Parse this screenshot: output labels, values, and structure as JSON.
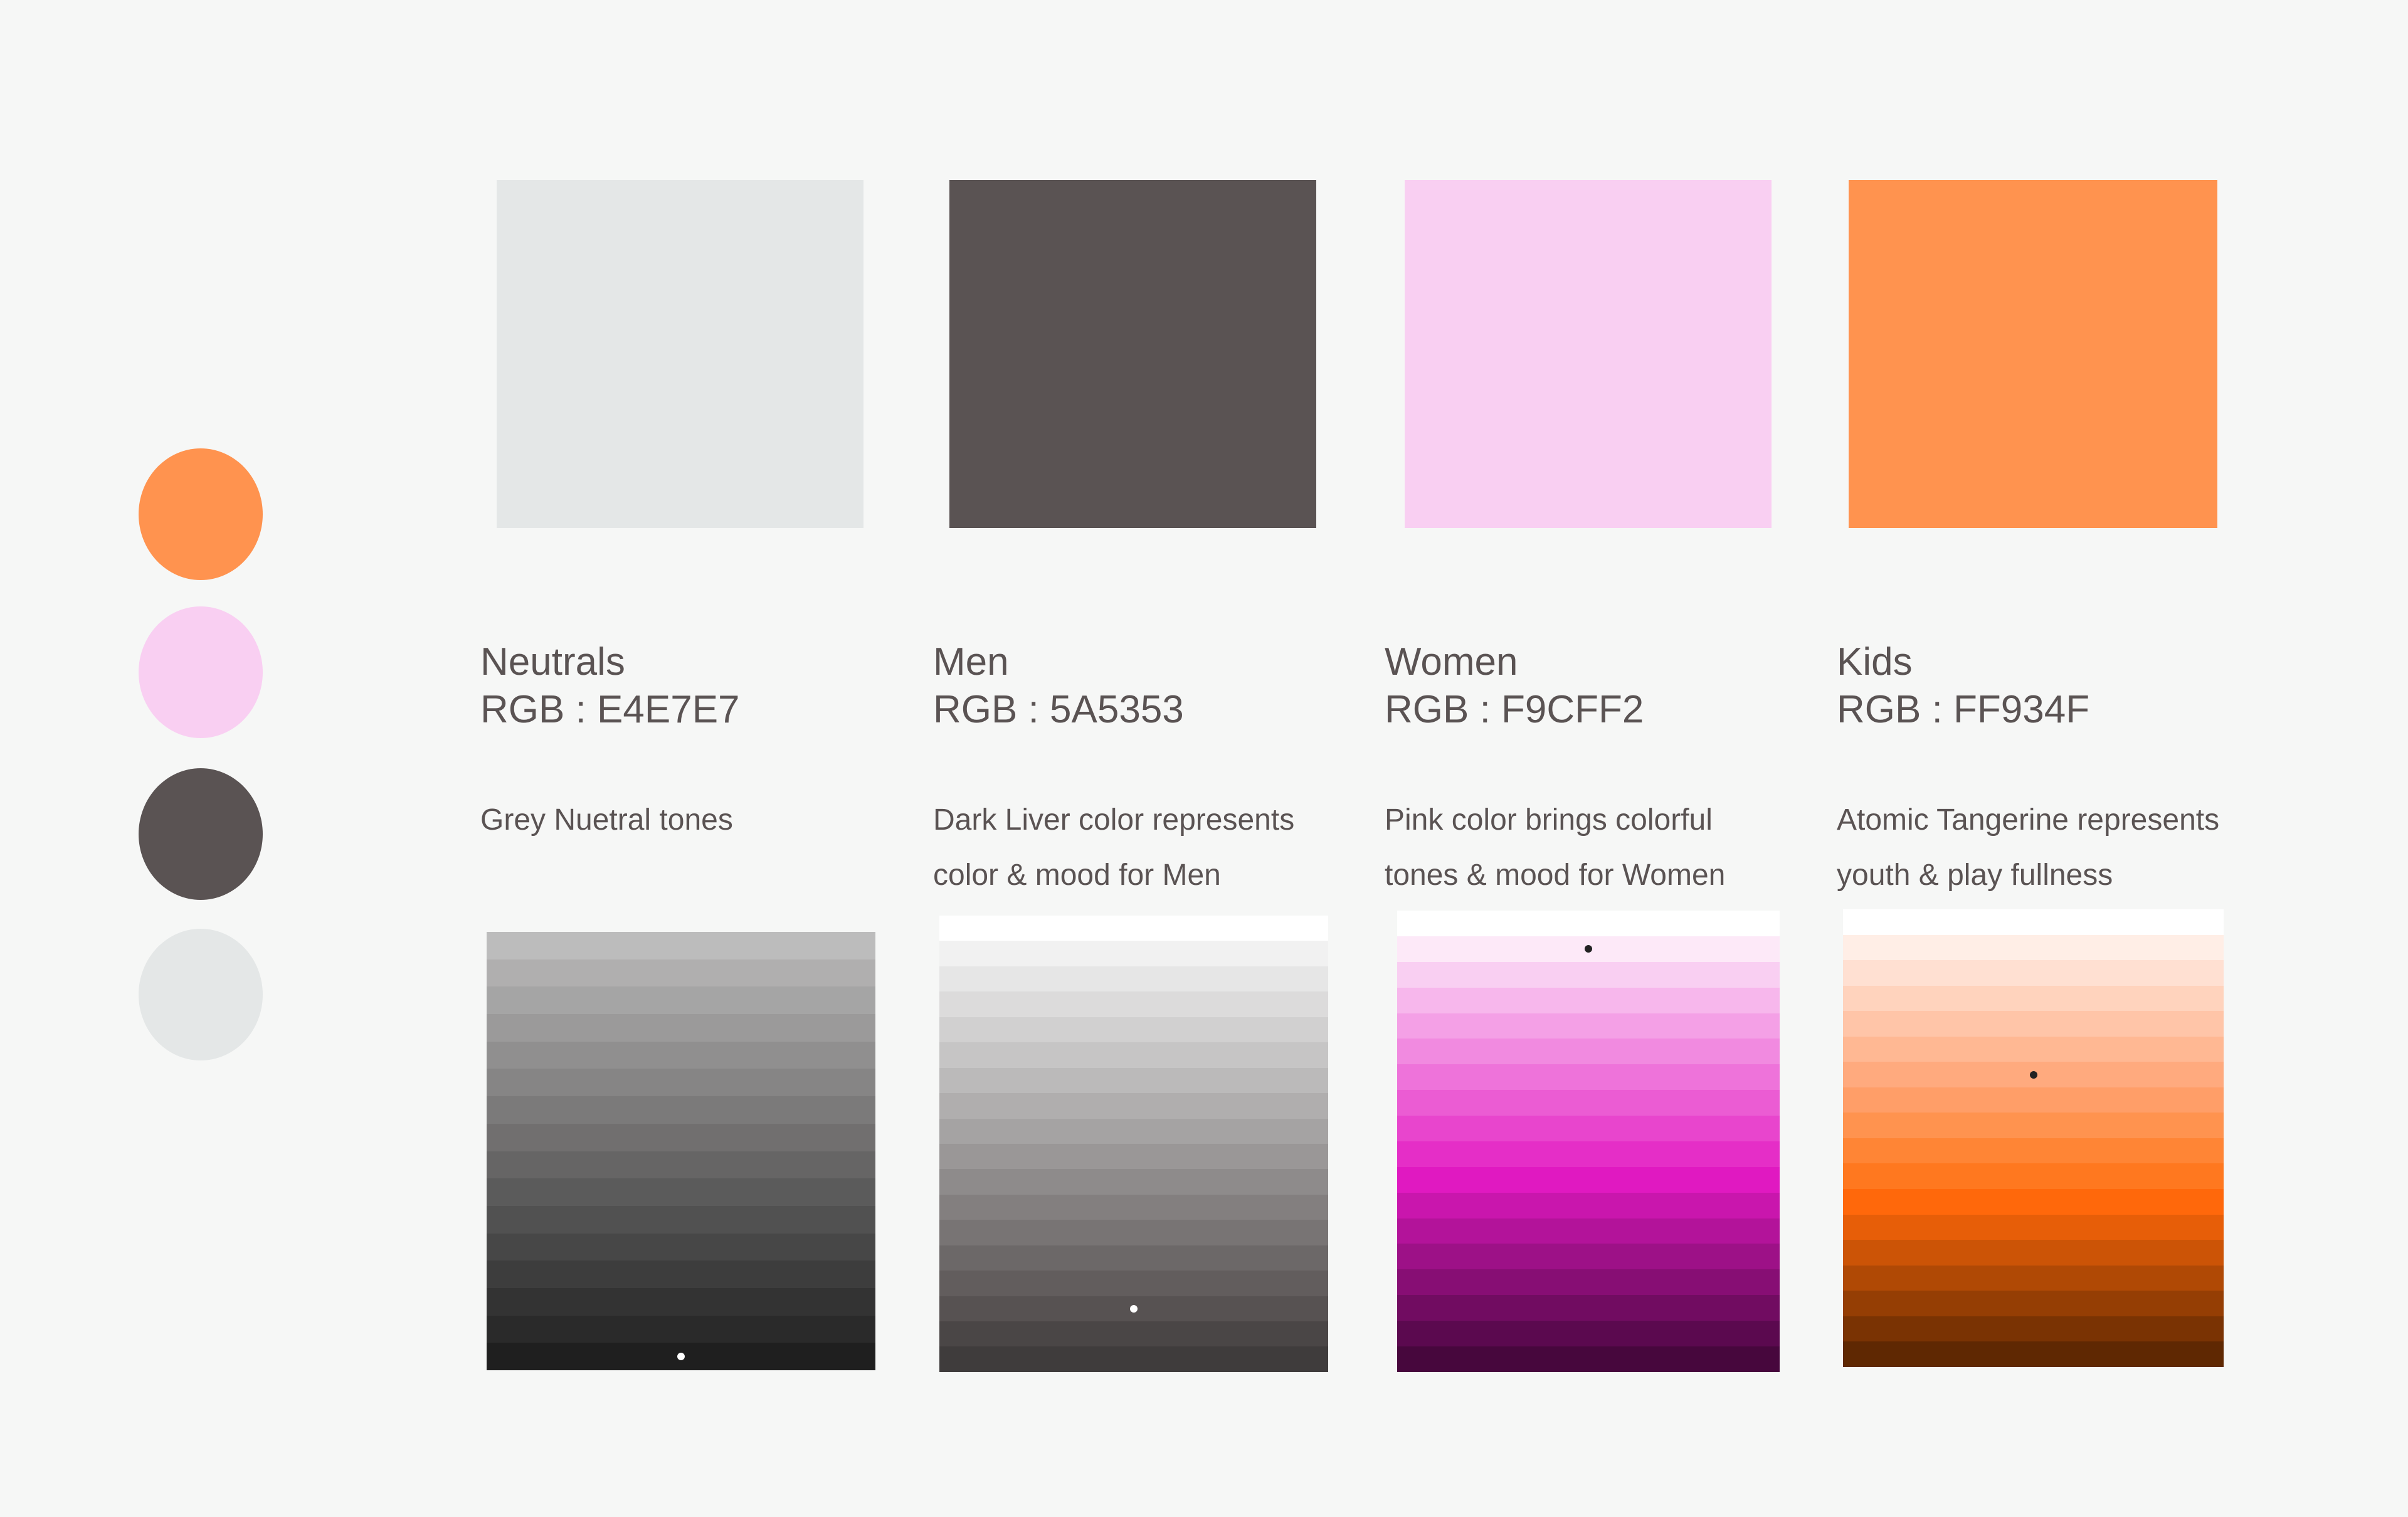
{
  "swatches": [
    {
      "name": "Neutrals",
      "rgb_label": "RGB : E4E7E7",
      "hex": "#E4E7E7",
      "description": [
        "Grey Nuetral tones"
      ]
    },
    {
      "name": "Men",
      "rgb_label": "RGB : 5A5353",
      "hex": "#5A5353",
      "description": [
        "Dark Liver color represents",
        "color & mood for Men"
      ]
    },
    {
      "name": "Women",
      "rgb_label": "RGB : F9CFF2",
      "hex": "#F9CFF2",
      "description": [
        "Pink color brings colorful",
        "tones & mood for Women"
      ]
    },
    {
      "name": "Kids",
      "rgb_label": "RGB : FF934F",
      "hex": "#FF934F",
      "description": [
        "Atomic Tangerine represents",
        "youth & play fullness"
      ]
    }
  ],
  "side_circles": [
    "#FF934F",
    "#F9CFF2",
    "#5A5353",
    "#E4E7E7"
  ],
  "ramps": [
    {
      "name": "neutrals-ramp",
      "marker_color": "#ffffff",
      "marker_step": 16,
      "steps": [
        "#bcbcbc",
        "#b0afaf",
        "#a5a5a5",
        "#9b9a9a",
        "#908f8f",
        "#868585",
        "#7b7a7a",
        "#716f6f",
        "#666565",
        "#5b5b5b",
        "#515151",
        "#474747",
        "#3d3d3d",
        "#333333",
        "#2a2a2a",
        "#1f1f1f"
      ]
    },
    {
      "name": "men-ramp",
      "marker_color": "#ffffff",
      "marker_step": 16,
      "steps": [
        "#ffffff",
        "#f1f1f1",
        "#e6e6e6",
        "#dcdbdb",
        "#d1d0d0",
        "#c6c5c5",
        "#bbbaba",
        "#b0aeae",
        "#a5a3a3",
        "#9a9797",
        "#8e8b8b",
        "#837f7f",
        "#787474",
        "#6c6868",
        "#625d5d",
        "#575252",
        "#4a4646",
        "#3f3c3c"
      ]
    },
    {
      "name": "women-ramp",
      "marker_color": "#222222",
      "marker_step": 2,
      "steps": [
        "#ffffff",
        "#fde9f8",
        "#f9cff2",
        "#f7b7ec",
        "#f4a0e6",
        "#f18ae0",
        "#ee73da",
        "#eb5cd3",
        "#e845cd",
        "#e52ec7",
        "#e019c1",
        "#c916ad",
        "#b3139a",
        "#9d1187",
        "#870e74",
        "#710c61",
        "#5b094f",
        "#47073d"
      ]
    },
    {
      "name": "kids-ramp",
      "marker_color": "#222222",
      "marker_step": 7,
      "steps": [
        "#ffffff",
        "#ffeee6",
        "#ffe0d2",
        "#ffd3bd",
        "#ffc5a8",
        "#ffb893",
        "#ffaa7e",
        "#ff9e68",
        "#ff934f",
        "#ff8535",
        "#ff781f",
        "#ff680b",
        "#e75e08",
        "#cc5406",
        "#b04905",
        "#953e04",
        "#7a3303",
        "#5f2802"
      ]
    }
  ]
}
